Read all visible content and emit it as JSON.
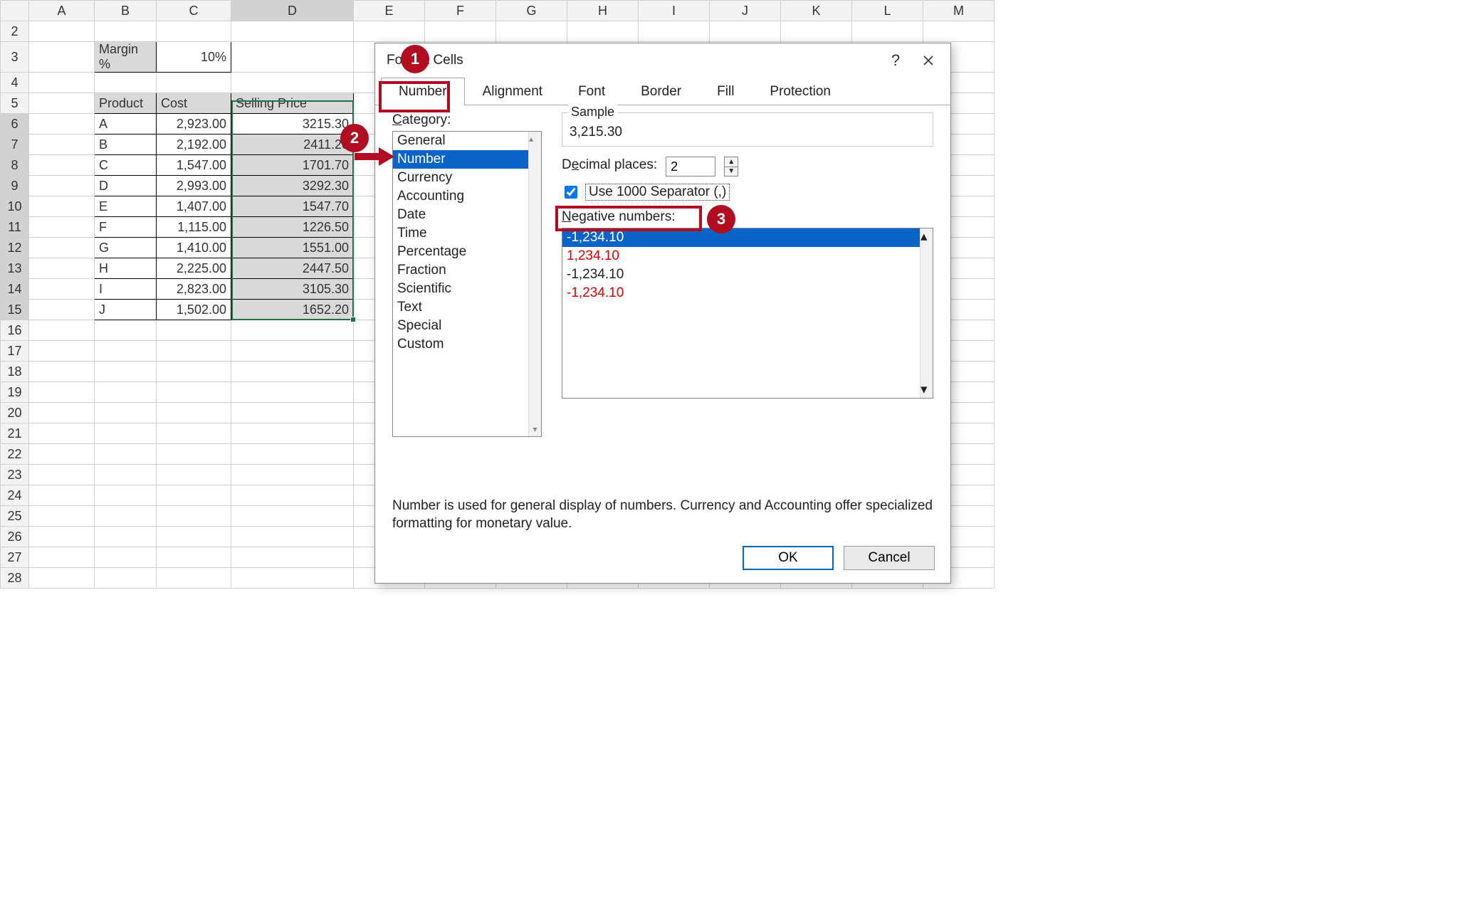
{
  "columns": [
    "A",
    "B",
    "C",
    "D",
    "E",
    "F",
    "G",
    "H",
    "I",
    "J",
    "K",
    "L",
    "M"
  ],
  "rows": [
    "2",
    "3",
    "4",
    "5",
    "6",
    "7",
    "8",
    "9",
    "10",
    "11",
    "12",
    "13",
    "14",
    "15",
    "16",
    "17",
    "18",
    "19",
    "20",
    "21",
    "22",
    "23",
    "24",
    "25",
    "26",
    "27",
    "28"
  ],
  "margin_label": "Margin %",
  "margin_value": "10%",
  "table_headers": {
    "b": "Product",
    "c": "Cost",
    "d": "Selling Price"
  },
  "table": [
    {
      "p": "A",
      "cost": "2,923.00",
      "sell": "3215.30"
    },
    {
      "p": "B",
      "cost": "2,192.00",
      "sell": "2411.20"
    },
    {
      "p": "C",
      "cost": "1,547.00",
      "sell": "1701.70"
    },
    {
      "p": "D",
      "cost": "2,993.00",
      "sell": "3292.30"
    },
    {
      "p": "E",
      "cost": "1,407.00",
      "sell": "1547.70"
    },
    {
      "p": "F",
      "cost": "1,115.00",
      "sell": "1226.50"
    },
    {
      "p": "G",
      "cost": "1,410.00",
      "sell": "1551.00"
    },
    {
      "p": "H",
      "cost": "2,225.00",
      "sell": "2447.50"
    },
    {
      "p": "I",
      "cost": "2,823.00",
      "sell": "3105.30"
    },
    {
      "p": "J",
      "cost": "1,502.00",
      "sell": "1652.20"
    }
  ],
  "dialog": {
    "title": "Format Cells",
    "tabs": [
      "Number",
      "Alignment",
      "Font",
      "Border",
      "Fill",
      "Protection"
    ],
    "active_tab": "Number",
    "category_label": "Category:",
    "categories": [
      "General",
      "Number",
      "Currency",
      "Accounting",
      "Date",
      "Time",
      "Percentage",
      "Fraction",
      "Scientific",
      "Text",
      "Special",
      "Custom"
    ],
    "selected_category": "Number",
    "sample_label": "Sample",
    "sample_value": "3,215.30",
    "decimal_label_pre": "D",
    "decimal_label_ul": "e",
    "decimal_label_post": "cimal places:",
    "decimal_value": "2",
    "use_sep_pre": "",
    "use_sep_ul": "U",
    "use_sep_post": "se 1000 Separator (,)",
    "negative_label_pre": "",
    "negative_label_ul": "N",
    "negative_label_post": "egative numbers:",
    "negatives": [
      {
        "text": "-1,234.10",
        "sel": true,
        "red": false
      },
      {
        "text": "1,234.10",
        "sel": false,
        "red": true
      },
      {
        "text": "-1,234.10",
        "sel": false,
        "red": false
      },
      {
        "text": "-1,234.10",
        "sel": false,
        "red": true
      }
    ],
    "description": "Number is used for general display of numbers.  Currency and Accounting offer specialized formatting for monetary value.",
    "ok": "OK",
    "cancel": "Cancel",
    "help": "?",
    "callouts": {
      "one": "1",
      "two": "2",
      "three": "3"
    }
  }
}
